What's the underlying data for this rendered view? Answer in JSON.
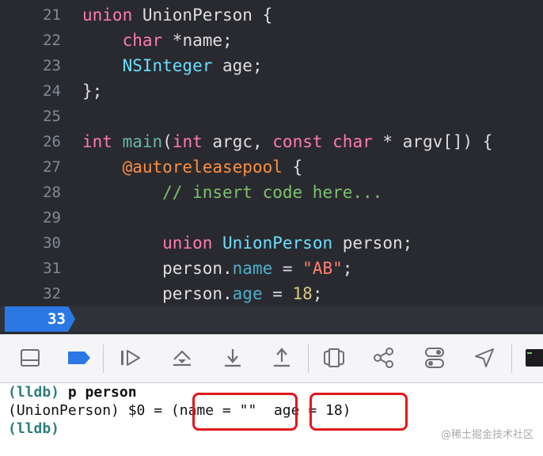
{
  "editor": {
    "lines": [
      {
        "num": "21",
        "tokens": [
          [
            "kw",
            "union"
          ],
          [
            "plain",
            " UnionPerson {"
          ]
        ]
      },
      {
        "num": "22",
        "tokens": [
          [
            "plain",
            "    "
          ],
          [
            "kw",
            "char"
          ],
          [
            "plain",
            " *name;"
          ]
        ]
      },
      {
        "num": "23",
        "tokens": [
          [
            "plain",
            "    "
          ],
          [
            "type",
            "NSInteger"
          ],
          [
            "plain",
            " age;"
          ]
        ]
      },
      {
        "num": "24",
        "tokens": [
          [
            "plain",
            "};"
          ]
        ]
      },
      {
        "num": "25",
        "tokens": []
      },
      {
        "num": "26",
        "tokens": [
          [
            "kw",
            "int"
          ],
          [
            "plain",
            " "
          ],
          [
            "fn",
            "main"
          ],
          [
            "plain",
            "("
          ],
          [
            "kw",
            "int"
          ],
          [
            "plain",
            " argc, "
          ],
          [
            "kw",
            "const"
          ],
          [
            "plain",
            " "
          ],
          [
            "kw",
            "char"
          ],
          [
            "plain",
            " * argv[]) {"
          ]
        ]
      },
      {
        "num": "27",
        "tokens": [
          [
            "plain",
            "    "
          ],
          [
            "dec",
            "@autoreleasepool"
          ],
          [
            "plain",
            " {"
          ]
        ]
      },
      {
        "num": "28",
        "tokens": [
          [
            "plain",
            "        "
          ],
          [
            "cmt",
            "// insert code here..."
          ]
        ]
      },
      {
        "num": "29",
        "tokens": []
      },
      {
        "num": "30",
        "tokens": [
          [
            "plain",
            "        "
          ],
          [
            "kw",
            "union"
          ],
          [
            "plain",
            " "
          ],
          [
            "type",
            "UnionPerson"
          ],
          [
            "plain",
            " person;"
          ]
        ]
      },
      {
        "num": "31",
        "tokens": [
          [
            "plain",
            "        person."
          ],
          [
            "prop",
            "name"
          ],
          [
            "plain",
            " = "
          ],
          [
            "str",
            "\"AB\""
          ],
          [
            "plain",
            ";"
          ]
        ]
      },
      {
        "num": "32",
        "tokens": [
          [
            "plain",
            "        person."
          ],
          [
            "prop",
            "age"
          ],
          [
            "plain",
            " = "
          ],
          [
            "num",
            "18"
          ],
          [
            "plain",
            ";"
          ]
        ]
      }
    ],
    "breakpoint_line": "33",
    "colors": {
      "background": "#292a30",
      "keyword": "#ff7ab2",
      "type": "#6bdfff",
      "comment": "#7ec16e",
      "string": "#ff8170",
      "number": "#d9c97c",
      "breakpoint": "#2b78e4"
    }
  },
  "toolbar": {
    "buttons": [
      {
        "name": "hide-debug-area-button",
        "icon": "panel-bottom-icon"
      },
      {
        "name": "breakpoints-toggle-button",
        "icon": "breakpoint-icon",
        "active": true
      },
      {
        "name": "continue-button",
        "icon": "continue-icon"
      },
      {
        "name": "step-over-button",
        "icon": "step-over-icon"
      },
      {
        "name": "step-into-button",
        "icon": "step-into-icon"
      },
      {
        "name": "step-out-button",
        "icon": "step-out-icon"
      },
      {
        "name": "debug-view-hierarchy-button",
        "icon": "view-hierarchy-icon"
      },
      {
        "name": "debug-memory-graph-button",
        "icon": "memory-graph-icon"
      },
      {
        "name": "environment-overrides-button",
        "icon": "toggles-icon"
      },
      {
        "name": "simulate-location-button",
        "icon": "location-arrow-icon"
      },
      {
        "name": "console-button",
        "icon": "terminal-icon"
      }
    ]
  },
  "console": {
    "line1_prompt": "(lldb)",
    "line1_cmd": " p person",
    "line2_prefix": "(UnionPerson) $0 = ",
    "line2_part1": "(name = \"\"",
    "line2_gap": "  ",
    "line2_part2": "age = 18)",
    "line3_prompt": "(lldb)",
    "highlight_color": "#e0191b"
  },
  "watermark": "@稀土掘金技术社区"
}
